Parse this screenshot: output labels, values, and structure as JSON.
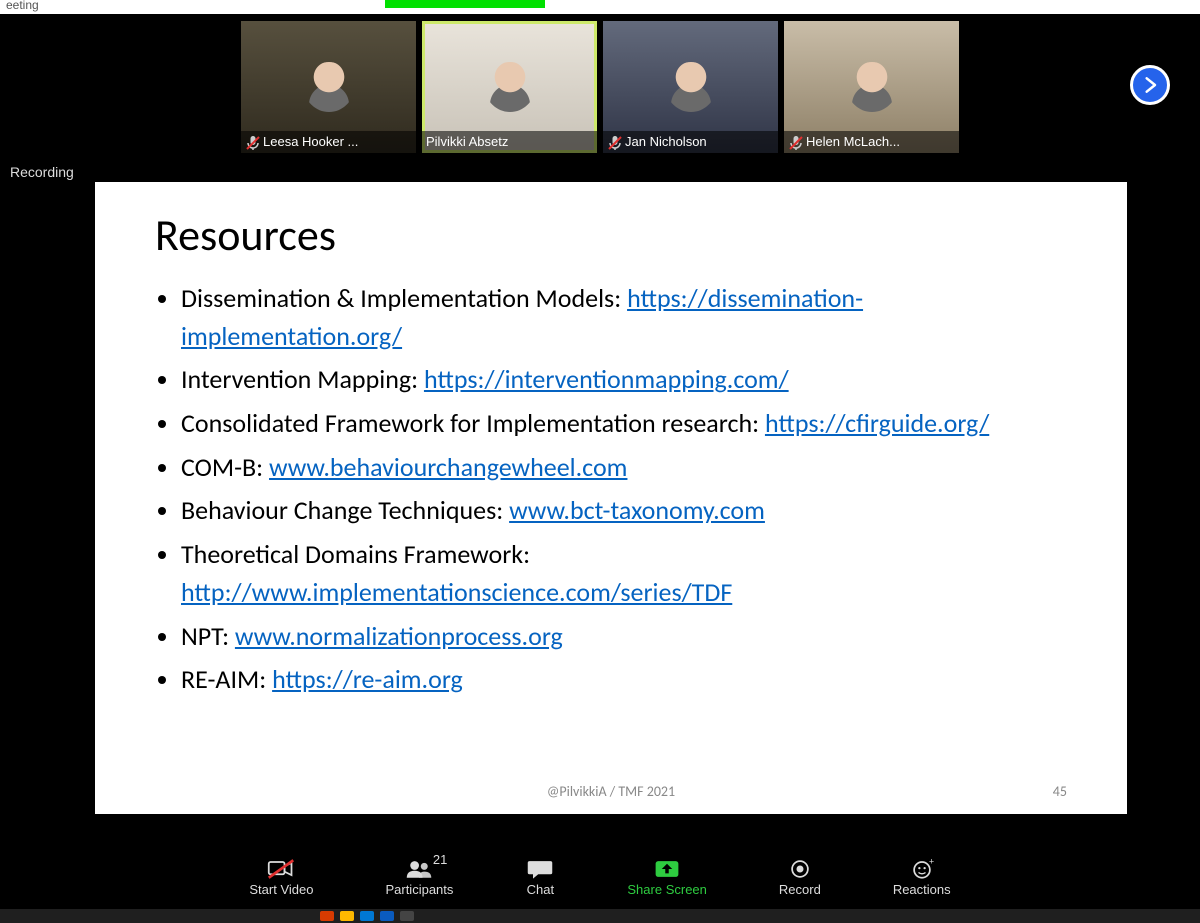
{
  "topbar_fragment": "eeting",
  "recording_label": "Recording",
  "participants": [
    {
      "name": "Leesa Hooker ...",
      "muted": true,
      "active": false
    },
    {
      "name": "Pilvikki Absetz",
      "muted": false,
      "active": true
    },
    {
      "name": "Jan Nicholson",
      "muted": true,
      "active": false
    },
    {
      "name": "Helen McLach...",
      "muted": true,
      "active": false
    }
  ],
  "slide": {
    "title": "Resources",
    "items": [
      {
        "label": "Dissemination & Implementation Models: ",
        "link": "https://dissemination-implementation.org/"
      },
      {
        "label": "Intervention Mapping: ",
        "link": "https://interventionmapping.com/"
      },
      {
        "label": "Consolidated Framework for Implementation research: ",
        "link": "https://cfirguide.org/"
      },
      {
        "label": "COM-B: ",
        "link": "www.behaviourchangewheel.com"
      },
      {
        "label": "Behaviour Change Techniques: ",
        "link": "www.bct-taxonomy.com"
      },
      {
        "label": "Theoretical Domains Framework: ",
        "link": "http://www.implementationscience.com/series/TDF"
      },
      {
        "label": "NPT: ",
        "link": "www.normalizationprocess.org"
      },
      {
        "label": "RE-AIM: ",
        "link": "https://re-aim.org"
      }
    ],
    "footer": "@PilvikkiA  / TMF 2021",
    "number": "45"
  },
  "toolbar": {
    "start_video": "Start Video",
    "participants_label": "Participants",
    "participants_count": "21",
    "chat": "Chat",
    "share": "Share Screen",
    "record": "Record",
    "reactions": "Reactions"
  },
  "tile_bg": {
    "0": "linear-gradient(180deg,#57503e 0%, #2f2a1e 100%)",
    "1": "linear-gradient(180deg,#e9e4db 0%, #c8c2b7 100%)",
    "2": "linear-gradient(180deg,#636a7c 0%, #2f3446 100%)",
    "3": "linear-gradient(180deg,#c9bda8 0%, #8d7f66 100%)"
  }
}
